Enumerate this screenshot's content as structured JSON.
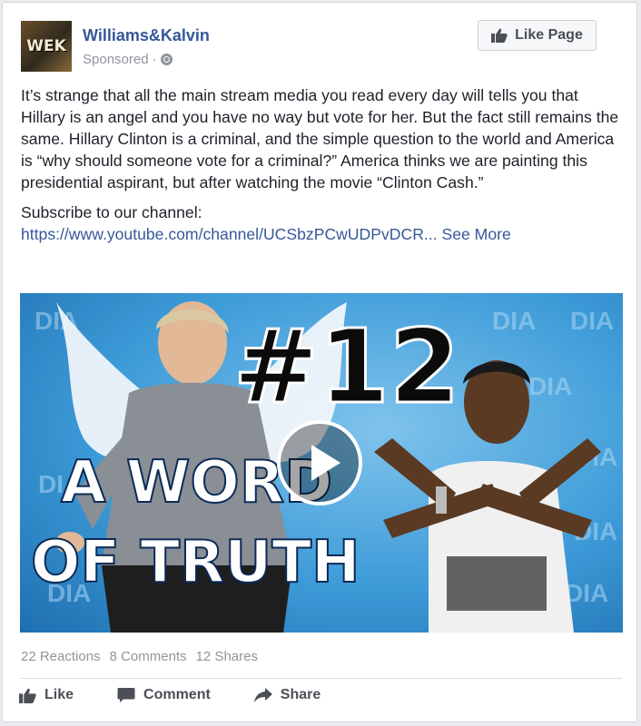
{
  "post": {
    "author": "Williams&Kalvin",
    "avatar_text": "WEK",
    "sponsored": "Sponsored",
    "meta_separator": "·",
    "privacy_icon": "globe-icon",
    "like_page_label": "Like Page",
    "body": "It’s strange that all the main stream media you read every day will tells you that Hillary is an angel and you have no way but vote for her. But the fact still remains the same. Hillary Clinton is a criminal, and the simple question to the world and America is “why should someone vote for a criminal?” America thinks we are painting this presidential aspirant, but after watching the movie “Clinton Cash.”",
    "subscribe_text": "Subscribe to our channel:",
    "link_text": "https://www.youtube.com/channel/UCSbzPCwUDPvDCR...",
    "see_more": "See More"
  },
  "video": {
    "episode": "#12",
    "title_line1": "A WORD",
    "title_line2": "OF TRUTH",
    "watermark": "DIA",
    "play_icon": "play-icon"
  },
  "engagement": {
    "reactions": "22 Reactions",
    "comments": "8 Comments",
    "shares": "12 Shares"
  },
  "actions": {
    "like": "Like",
    "comment": "Comment",
    "share": "Share"
  },
  "colors": {
    "link": "#365899",
    "muted": "#90949c",
    "text": "#1d2129",
    "video_bg": "#3d9bd8"
  }
}
